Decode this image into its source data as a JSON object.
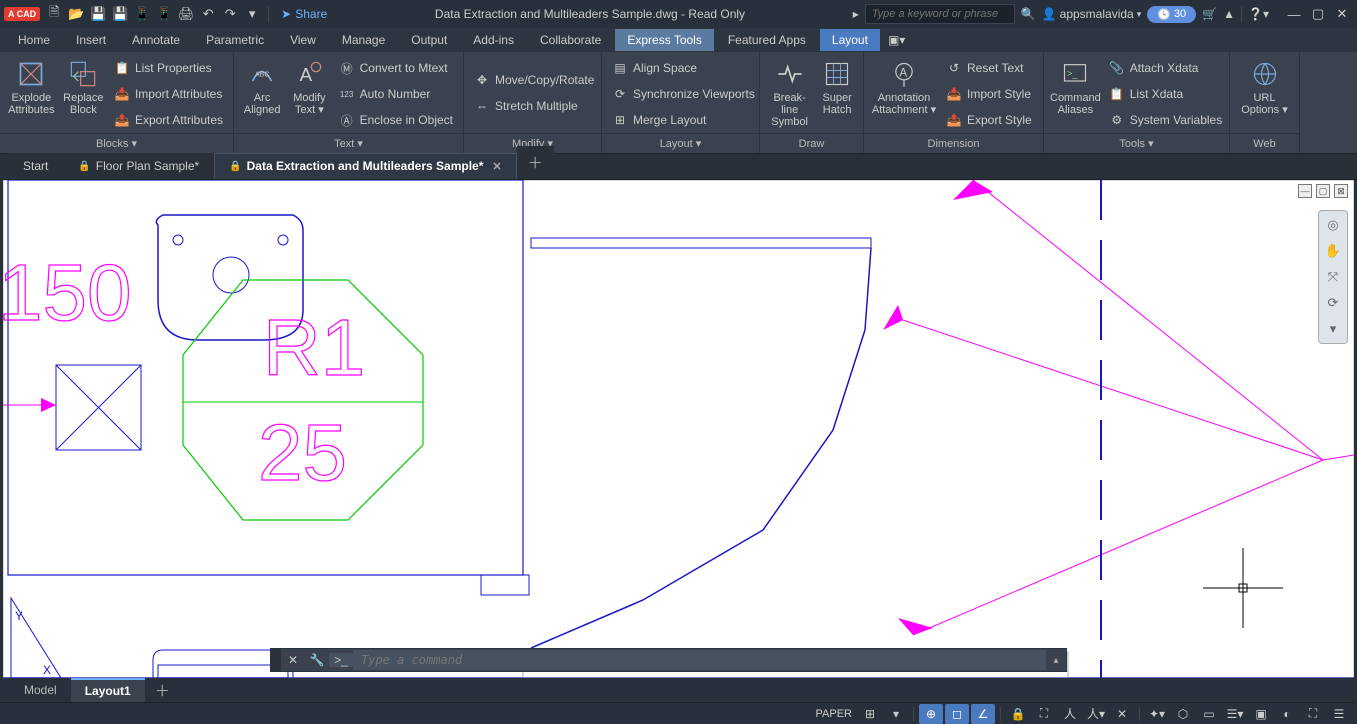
{
  "titlebar": {
    "share": "Share",
    "title": "Data Extraction and Multileaders Sample.dwg - Read Only",
    "search_placeholder": "Type a keyword or phrase",
    "username": "appsmalavida",
    "days_badge": "30"
  },
  "menutabs": [
    "Home",
    "Insert",
    "Annotate",
    "Parametric",
    "View",
    "Manage",
    "Output",
    "Add-ins",
    "Collaborate",
    "Express Tools",
    "Featured Apps",
    "Layout"
  ],
  "ribbon": {
    "blocks": {
      "title": "Blocks",
      "explode": "Explode\nAttributes",
      "replace": "Replace\nBlock",
      "list_props": "List Properties",
      "import_attrs": "Import Attributes",
      "export_attrs": "Export Attributes"
    },
    "text": {
      "title": "Text",
      "arc": "Arc\nAligned",
      "modify": "Modify\nText",
      "convert": "Convert to Mtext",
      "autonum": "Auto Number",
      "enclose": "Enclose in Object"
    },
    "modify": {
      "title": "Modify",
      "move": "Move/Copy/Rotate",
      "stretch": "Stretch Multiple"
    },
    "layout": {
      "title": "Layout",
      "align": "Align Space",
      "sync": "Synchronize Viewports",
      "merge": "Merge Layout"
    },
    "draw": {
      "title": "Draw",
      "breakline": "Break-line\nSymbol",
      "hatch": "Super\nHatch"
    },
    "dimension": {
      "title": "Dimension",
      "annot": "Annotation\nAttachment",
      "reset": "Reset Text",
      "import": "Import Style",
      "export": "Export Style"
    },
    "tools": {
      "title": "Tools",
      "cmd": "Command\nAliases",
      "attach": "Attach Xdata",
      "list": "List Xdata",
      "sys": "System Variables"
    },
    "web": {
      "title": "Web",
      "url": "URL\nOptions"
    }
  },
  "filetabs": {
    "start": "Start",
    "floor": "Floor Plan Sample*",
    "data": "Data Extraction and Multileaders Sample*"
  },
  "canvas": {
    "text150": "150",
    "textR1": "R1",
    "text25": "25"
  },
  "cmdline": {
    "placeholder": "Type a command"
  },
  "layouttabs": {
    "model": "Model",
    "layout1": "Layout1"
  },
  "status": {
    "paper": "PAPER"
  }
}
